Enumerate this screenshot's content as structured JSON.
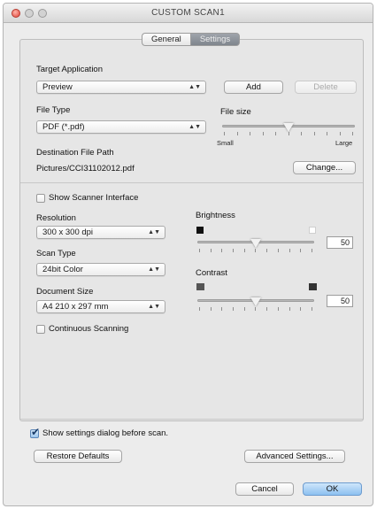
{
  "window": {
    "title": "CUSTOM SCAN1"
  },
  "tabs": [
    {
      "label": "General",
      "active": false
    },
    {
      "label": "Settings",
      "active": true
    }
  ],
  "target_application": {
    "label": "Target Application",
    "value": "Preview",
    "add_label": "Add",
    "delete_label": "Delete"
  },
  "file_type": {
    "label": "File Type",
    "value": "PDF (*.pdf)"
  },
  "file_size": {
    "label": "File size",
    "small_label": "Small",
    "large_label": "Large",
    "level": 0.5
  },
  "destination": {
    "label": "Destination File Path",
    "value": "Pictures/CCI31102012.pdf",
    "change_label": "Change..."
  },
  "show_scanner_interface": {
    "label": "Show Scanner Interface",
    "checked": false
  },
  "resolution": {
    "label": "Resolution",
    "value": "300 x 300 dpi"
  },
  "scan_type": {
    "label": "Scan Type",
    "value": "24bit Color"
  },
  "document_size": {
    "label": "Document Size",
    "value": "A4 210 x 297 mm"
  },
  "continuous_scanning": {
    "label": "Continuous Scanning",
    "checked": false
  },
  "brightness": {
    "label": "Brightness",
    "value": "50"
  },
  "contrast": {
    "label": "Contrast",
    "value": "50"
  },
  "show_settings_dialog": {
    "label": "Show settings dialog before scan.",
    "checked": true
  },
  "buttons": {
    "restore_defaults": "Restore Defaults",
    "advanced_settings": "Advanced Settings...",
    "cancel": "Cancel",
    "ok": "OK"
  },
  "colors": {
    "accent": "#8cc0f0",
    "tab_active": "#8a9098"
  }
}
